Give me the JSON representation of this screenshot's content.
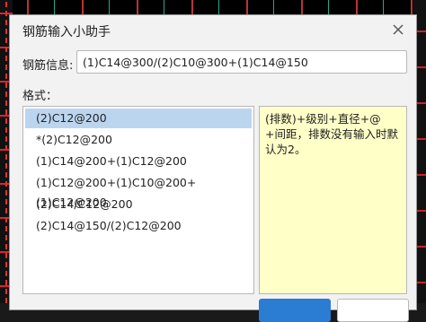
{
  "dialog": {
    "title": "钢筋输入小助手",
    "close_icon": "close-icon"
  },
  "info": {
    "label": "钢筋信息:",
    "value": "(1)C14@300/(2)C10@300+(1)C14@150"
  },
  "format": {
    "label": "格式：",
    "items": [
      "(2)C12@200",
      "*(2)C12@200",
      "(1)C14@200+(1)C12@200",
      "(1)C12@200+(1)C10@200+(1)C12@200",
      "(2)C14/C12@200",
      "(2)C14@150/(2)C12@200"
    ],
    "selected_index": 0
  },
  "help_text": "(排数)+级别+直径+@+间距，排数没有输入时默认为2。",
  "colors": {
    "selected_row": "#bcd5ef",
    "help_bg": "#ffffc8",
    "primary_button": "#2b7cd3"
  }
}
